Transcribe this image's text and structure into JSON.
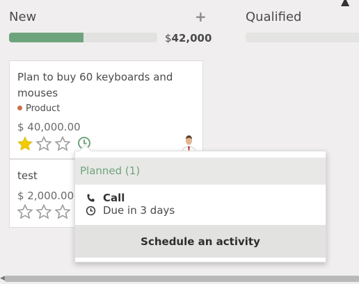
{
  "columns": {
    "new": {
      "title": "New",
      "add_label": "+",
      "total_currency": "$",
      "total_amount": "42,000",
      "progress": 0.5
    },
    "qualified": {
      "title": "Qualified"
    }
  },
  "cards": [
    {
      "title": "Plan to buy 60 keyboards and mouses",
      "tag": "Product",
      "revenue": "$ 40,000.00",
      "stars": 1
    },
    {
      "title": "test",
      "revenue": "$ 2,000.00",
      "stars": 0
    }
  ],
  "popover": {
    "header": "Planned (1)",
    "activity": {
      "type": "Call",
      "due": "Due in 3 days"
    },
    "footer_button": "Schedule an activity"
  },
  "colors": {
    "progress_green": "#6ea47d",
    "star_gold": "#f3cc00",
    "tag_dot": "#c7714a"
  },
  "icons": {
    "add": "plus-icon",
    "star": "star-icon",
    "activity": "clock-icon",
    "call": "phone-icon",
    "due": "clock-icon"
  }
}
